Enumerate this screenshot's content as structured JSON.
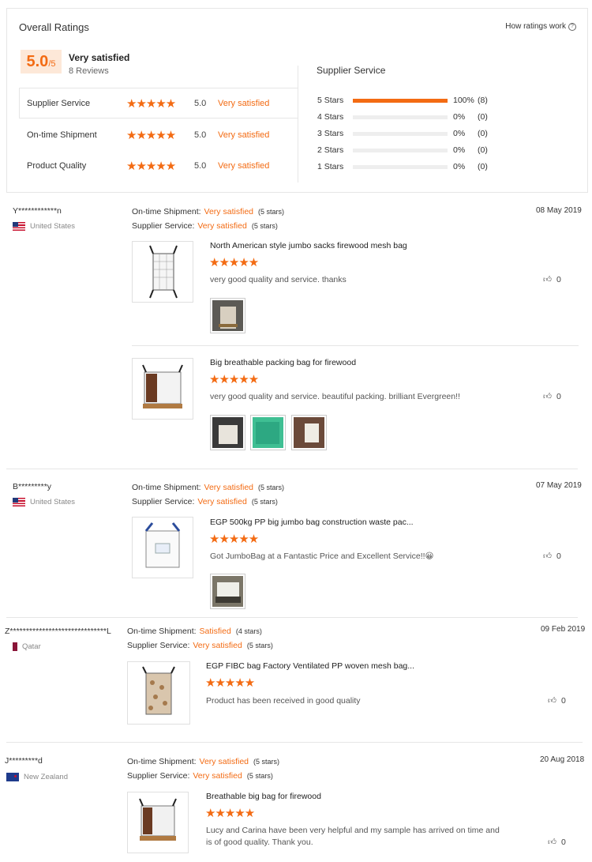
{
  "overall": {
    "title": "Overall Ratings",
    "how_link": "How ratings work",
    "score_big": "5.0",
    "score_small": "/5",
    "score_label": "Very satisfied",
    "reviews_count": "8 Reviews",
    "rows": [
      {
        "label": "Supplier Service",
        "score": "5.0",
        "text": "Very satisfied"
      },
      {
        "label": "On-time Shipment",
        "score": "5.0",
        "text": "Very satisfied"
      },
      {
        "label": "Product Quality",
        "score": "5.0",
        "text": "Very satisfied"
      }
    ],
    "breakdown_title": "Supplier Service",
    "breakdown": [
      {
        "label": "5 Stars",
        "fill": 1.0,
        "pct": "100%",
        "count": "(8)"
      },
      {
        "label": "4 Stars",
        "fill": 0,
        "pct": "0%",
        "count": "(0)"
      },
      {
        "label": "3 Stars",
        "fill": 0,
        "pct": "0%",
        "count": "(0)"
      },
      {
        "label": "2 Stars",
        "fill": 0,
        "pct": "0%",
        "count": "(0)"
      },
      {
        "label": "1 Stars",
        "fill": 0,
        "pct": "0%",
        "count": "(0)"
      }
    ]
  },
  "labels": {
    "shipment": "On-time Shipment:",
    "service": "Supplier Service:"
  },
  "reviews": [
    {
      "user": "Y************n",
      "country": "United States",
      "date": "08 May 2019",
      "shipment_val": "Very satisfied",
      "shipment_cnt": "(5 stars)",
      "service_val": "Very satisfied",
      "service_cnt": "(5 stars)",
      "items": [
        {
          "name": "North American style jumbo sacks firewood mesh bag",
          "text": "very good quality and service. thanks",
          "likes": "0"
        },
        {
          "name": "Big breathable packing bag for firewood",
          "text": "very good quality and service. beautiful packing. brilliant Evergreen!!",
          "likes": "0"
        }
      ]
    },
    {
      "user": "B*********y",
      "country": "United States",
      "date": "07 May 2019",
      "shipment_val": "Very satisfied",
      "shipment_cnt": "(5 stars)",
      "service_val": "Very satisfied",
      "service_cnt": "(5 stars)",
      "items": [
        {
          "name": "EGP 500kg PP big jumbo bag construction waste pac...",
          "text": "Got JumboBag at a Fantastic Price and Excellent Service!!😀",
          "likes": "0"
        }
      ]
    },
    {
      "user": "Z******************************L",
      "country": "Qatar",
      "date": "09 Feb 2019",
      "shipment_val": "Satisfied",
      "shipment_cnt": "(4 stars)",
      "service_val": "Very satisfied",
      "service_cnt": "(5 stars)",
      "items": [
        {
          "name": "EGP FIBC bag Factory Ventilated PP woven mesh bag...",
          "text": "Product has been received in good quality",
          "likes": "0"
        }
      ]
    },
    {
      "user": "J*********d",
      "country": "New Zealand",
      "date": "20 Aug 2018",
      "shipment_val": "Very satisfied",
      "shipment_cnt": "(5 stars)",
      "service_val": "Very satisfied",
      "service_cnt": "(5 stars)",
      "items": [
        {
          "name": "Breathable big bag for firewood",
          "text_line1": "Lucy and Carina have been very helpful and my sample has arrived on time and",
          "text_line2": "is of good quality. Thank you.",
          "likes": "0"
        }
      ]
    }
  ],
  "stars": "★★★★★",
  "colors": {
    "accent": "#f36b13",
    "score_bg": "#fde8d8"
  }
}
